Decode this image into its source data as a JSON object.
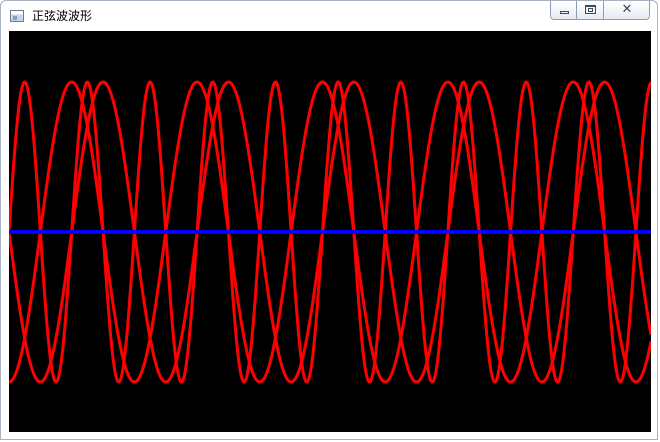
{
  "window": {
    "title": "正弦波波形",
    "icon": "app-window-icon",
    "buttons": [
      "minimize",
      "maximize",
      "close"
    ]
  },
  "canvas": {
    "background": "#000000",
    "axis_color": "#0000ff",
    "wave_color": "#ff0000"
  },
  "chart_data": {
    "type": "line",
    "title": "",
    "xlabel": "",
    "ylabel": "",
    "grid": false,
    "xlim": [
      0,
      640
    ],
    "ylim": [
      -150,
      150
    ],
    "series": [
      {
        "color": "#ff0000",
        "amplitude": 150,
        "period": 125,
        "phase": 0
      },
      {
        "color": "#ff0000",
        "amplitude": 150,
        "period": 125,
        "phase": 0.5
      },
      {
        "color": "#ff0000",
        "amplitude": 150,
        "period": 62.5,
        "phase": 1
      }
    ],
    "baseline": {
      "color": "#0000ff",
      "y": 0
    }
  }
}
